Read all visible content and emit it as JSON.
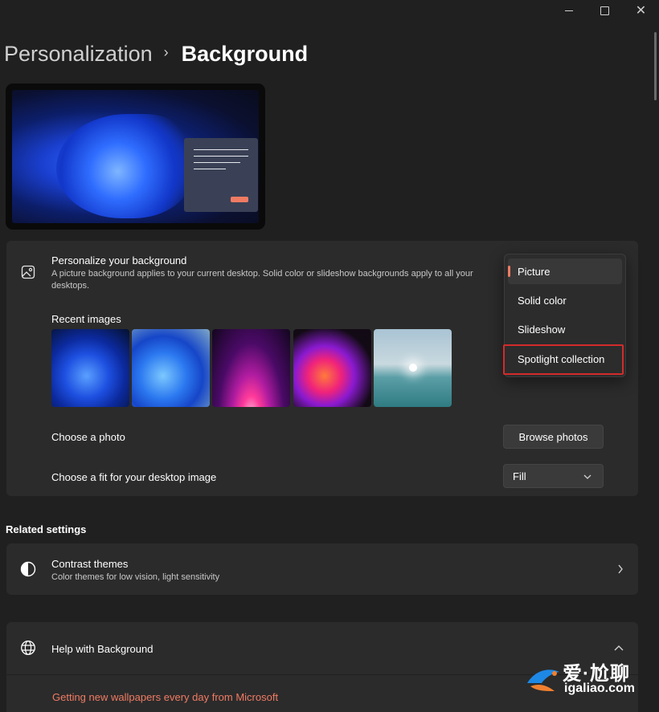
{
  "window": {
    "minimize_label": "—",
    "maximize_label": "□",
    "close_label": "✕"
  },
  "breadcrumb": {
    "parent": "Personalization",
    "separator": "›",
    "current": "Background"
  },
  "personalize": {
    "title": "Personalize your background",
    "description": "A picture background applies to your current desktop. Solid color or slideshow backgrounds apply to all your desktops.",
    "icon": "image-icon"
  },
  "background_type_menu": {
    "options": [
      "Picture",
      "Solid color",
      "Slideshow",
      "Spotlight collection"
    ],
    "selected": "Picture",
    "highlighted": "Spotlight collection"
  },
  "recent_images": {
    "label": "Recent images",
    "items": [
      "bloom-dark-blue",
      "bloom-light-blue",
      "magenta-glow",
      "colorful-ribbons",
      "seaside-sunset"
    ]
  },
  "choose_photo": {
    "label": "Choose a photo",
    "button": "Browse photos"
  },
  "fit": {
    "label": "Choose a fit for your desktop image",
    "value": "Fill"
  },
  "related_settings": {
    "heading": "Related settings",
    "contrast_themes": {
      "title": "Contrast themes",
      "subtitle": "Color themes for low vision, light sensitivity",
      "icon": "contrast-icon"
    }
  },
  "help": {
    "title": "Help with Background",
    "icon": "globe-icon",
    "link": "Getting new wallpapers every day from Microsoft"
  },
  "watermark": {
    "line1": "爱·尬聊",
    "line2": "igaliao.com"
  },
  "colors": {
    "background": "#202020",
    "card": "#2b2b2b",
    "accent": "#f07b63",
    "highlight_border": "#d32b2b"
  }
}
